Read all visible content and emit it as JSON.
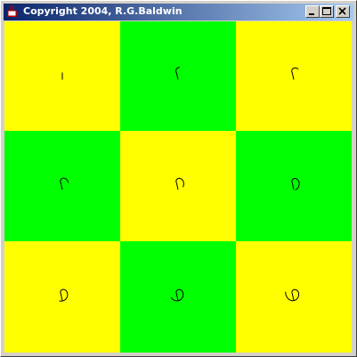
{
  "window": {
    "title": "Copyright 2004, R.G.Baldwin",
    "icon": "java-cup-icon",
    "buttons": [
      "minimize-icon",
      "maximize-icon",
      "close-icon"
    ]
  },
  "colors": {
    "yellow": "#ffff00",
    "green": "#00ff00",
    "curve": "#000000"
  },
  "grid": {
    "rows": 3,
    "cols": 3,
    "cells": [
      {
        "color": "yellow",
        "curve_level": 1
      },
      {
        "color": "green",
        "curve_level": 2
      },
      {
        "color": "yellow",
        "curve_level": 3
      },
      {
        "color": "green",
        "curve_level": 4
      },
      {
        "color": "yellow",
        "curve_level": 5
      },
      {
        "color": "green",
        "curve_level": 6
      },
      {
        "color": "yellow",
        "curve_level": 7
      },
      {
        "color": "green",
        "curve_level": 8
      },
      {
        "color": "yellow",
        "curve_level": 9
      }
    ]
  }
}
